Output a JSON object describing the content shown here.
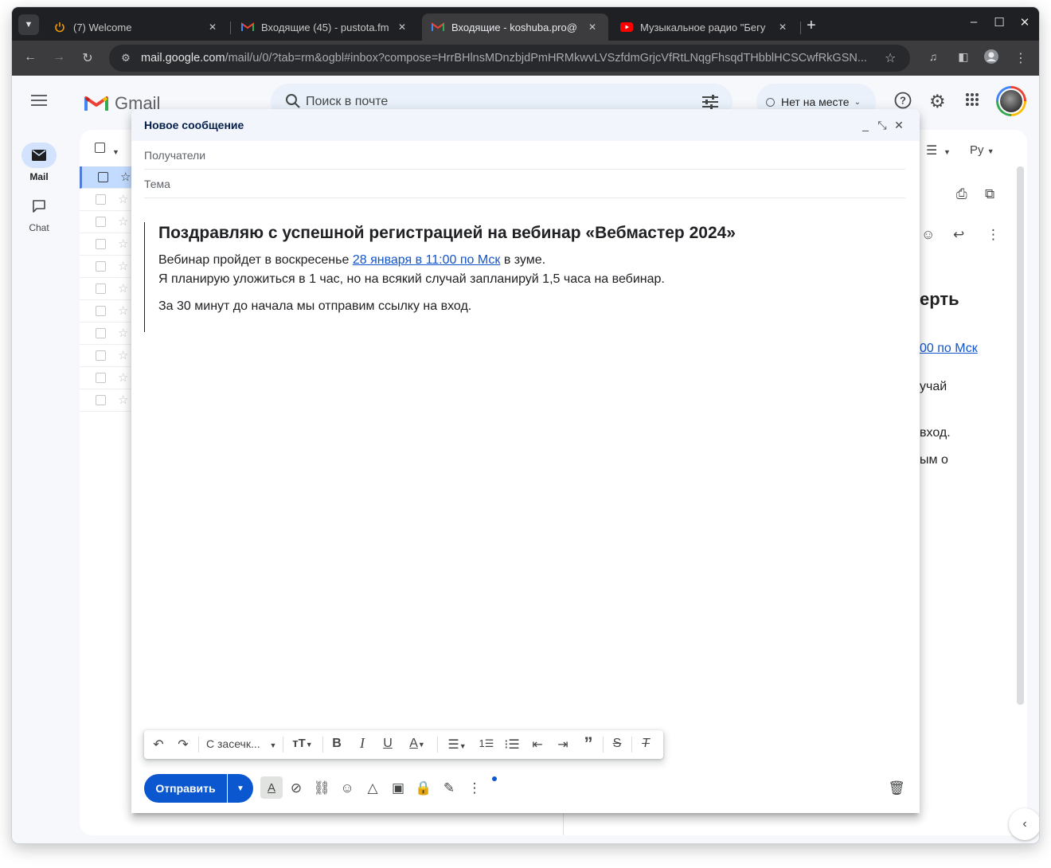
{
  "tabs": [
    {
      "label": "(7) Welcome",
      "icon": "power-icon"
    },
    {
      "label": "Входящие (45) - pustota.fm",
      "icon": "gmail-icon"
    },
    {
      "label": "Входящие - koshuba.pro@",
      "icon": "gmail-icon",
      "active": true
    },
    {
      "label": "Музыкальное радио \"Бегу",
      "icon": "youtube-icon"
    }
  ],
  "address_bar": {
    "url_host": "mail.google.com",
    "url_path": "/mail/u/0/?tab=rm&ogbl#inbox?compose=HrrBHlnsMDnzbjdPmHRMkwvLVSzfdmGrjcVfRtLNqgFhsqdTHbblHCSCwfRkGSN..."
  },
  "gmail": {
    "logo_text": "Gmail",
    "search_placeholder": "Поиск в почте",
    "status": "Нет на месте",
    "rail": {
      "mail": "Mail",
      "chat": "Chat"
    },
    "lang_button": "Ру"
  },
  "reading_pane": {
    "heading_fragment": "ерть",
    "link_fragment": "00 по Мск",
    "line1": "учай",
    "line2": "вход.",
    "line3": "ым о"
  },
  "compose": {
    "title": "Новое сообщение",
    "to_placeholder": "Получатели",
    "subject_placeholder": "Тема",
    "body": {
      "heading": "Поздравляю с успешной регистрацией на вебинар «Вебмастер 2024»",
      "p1_before": "Вебинар пройдет в воскресенье ",
      "p1_link": "28 января в 11:00 по Мск",
      "p1_after": " в зуме.",
      "p2": "Я планирую уложиться в 1 час, но на всякий случай запланируй 1,5 часа на вебинар.",
      "p3": "За 30 минут до начала мы отправим ссылку на вход."
    },
    "font_name": "С засечк...",
    "send_label": "Отправить"
  },
  "colors": {
    "send_button": "#0b57d0",
    "link": "#1155cc",
    "selected_row": "#c2dbff"
  }
}
